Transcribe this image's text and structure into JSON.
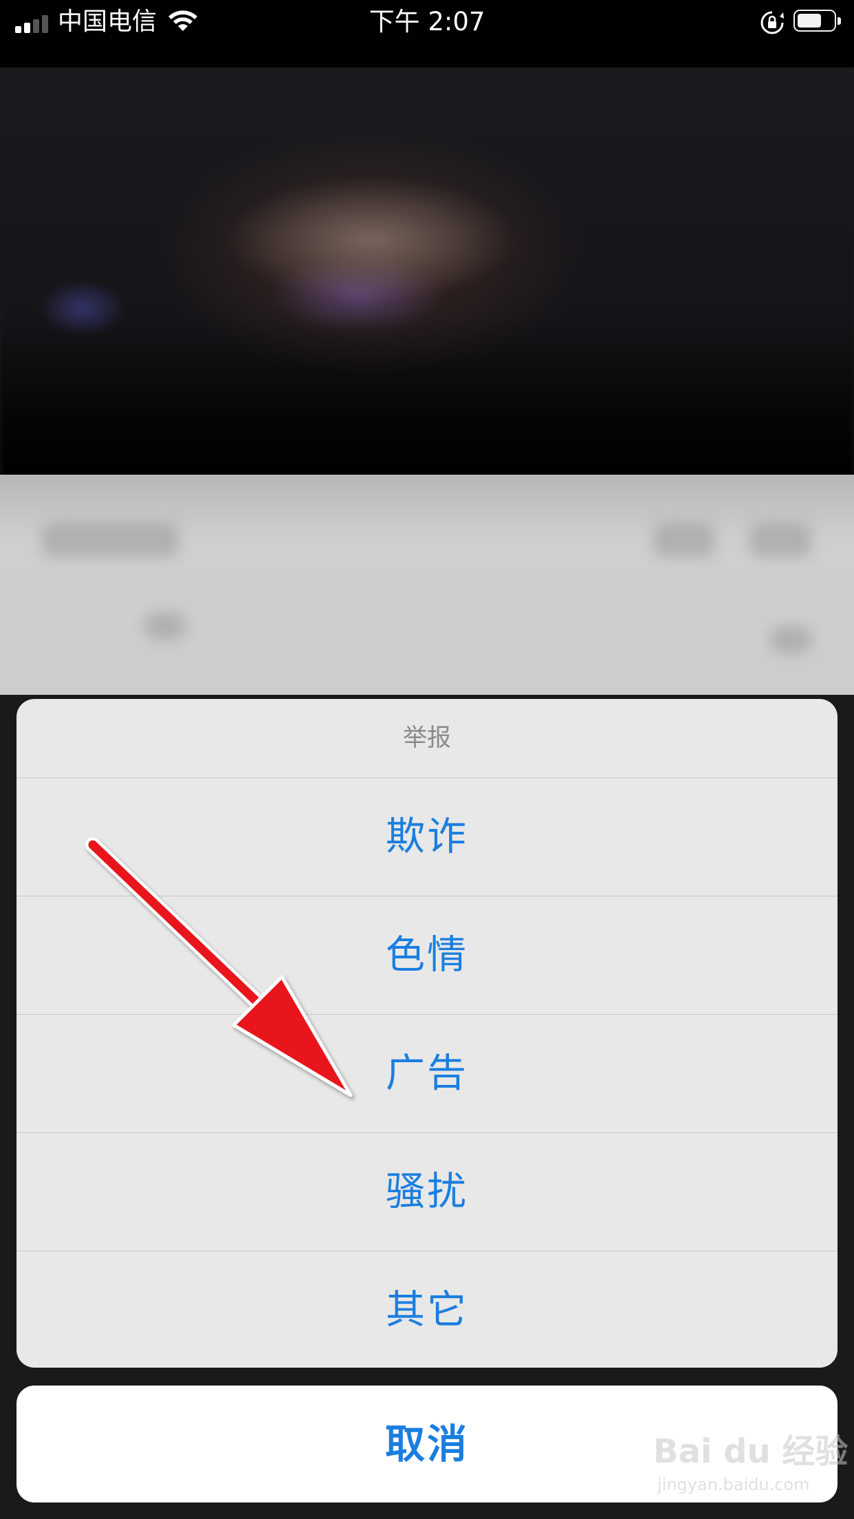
{
  "status_bar": {
    "carrier": "中国电信",
    "time": "下午 2:07",
    "signal_bars": 4,
    "signal_filled": 2,
    "battery_level": 0.65
  },
  "action_sheet": {
    "title": "举报",
    "options": [
      {
        "label": "欺诈"
      },
      {
        "label": "色情"
      },
      {
        "label": "广告"
      },
      {
        "label": "骚扰"
      },
      {
        "label": "其它"
      }
    ],
    "cancel_label": "取消"
  },
  "watermark": {
    "logo": "Bai du 经验",
    "url": "jingyan.baidu.com"
  },
  "colors": {
    "accent": "#1a7ee0",
    "annotation_arrow": "#e8141b"
  },
  "icons": [
    "signal-icon",
    "wifi-icon",
    "rotation-lock-icon",
    "battery-icon"
  ]
}
